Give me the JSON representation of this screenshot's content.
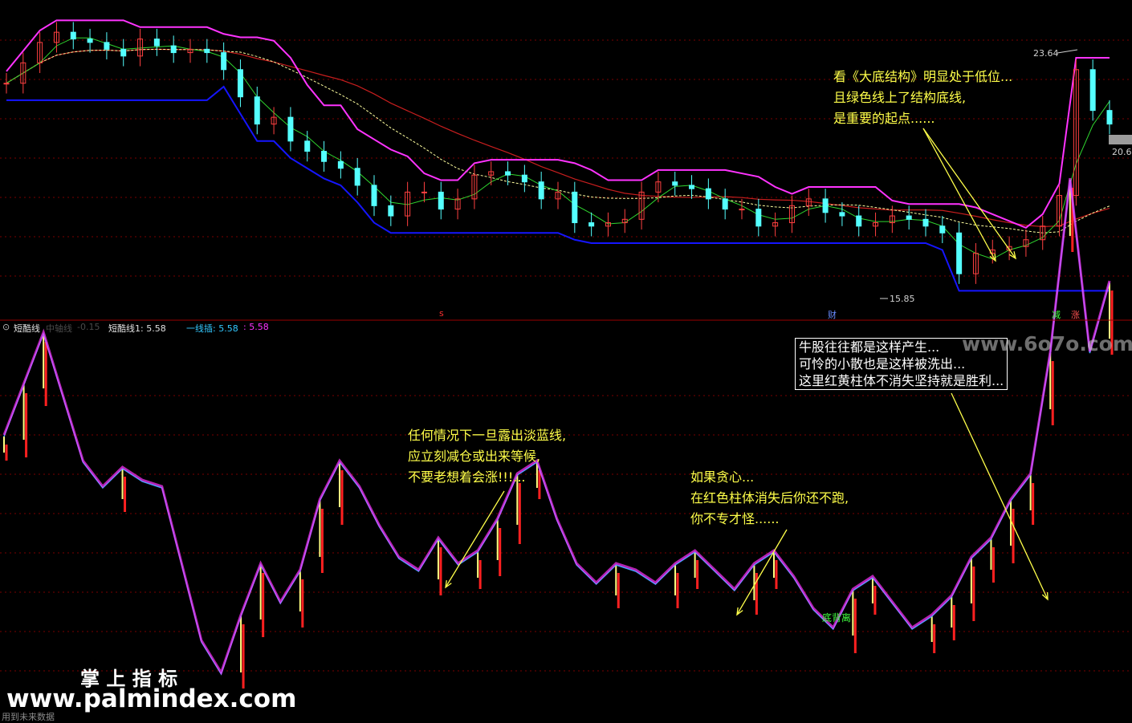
{
  "colors": {
    "background": "#000000",
    "grid": "#7a0000",
    "candle_up": "#ff4040",
    "candle_down": "#54ffff",
    "upper_band": "#ff33ff",
    "lower_band": "#1515ff",
    "green_line": "#2fd52f",
    "ma_red": "#c81e1e",
    "ma_dashed": "#ffffa0",
    "osc_line": "#3aa8ff",
    "osc_fill": "#ff33ff",
    "bar_red": "#ff2020",
    "bar_yellow": "#ffff80",
    "annotation": "#ffff4a"
  },
  "upper_panel": {
    "labels": {
      "high": "23.64",
      "low": "15.85",
      "last": "20.6",
      "mark_s": "s",
      "mark_cai": "财",
      "mark_jian": "减",
      "mark_zhang": "涨"
    },
    "annotation": "看《大底结构》明显处于低位...\n且绿色线上了结构底线,\n是重要的起点......"
  },
  "indicator_bar": {
    "name": "短酷线",
    "dim_label": "中轴线",
    "dim_value": "-0.15",
    "line1_label": "短酷线1: 5.58",
    "line2_label": "一线插: 5.58",
    "line2_value": ": 5.58"
  },
  "lower_panel": {
    "annotation_1": "任何情况下一旦露出淡蓝线,\n应立刻减仓或出来等候,\n不要老想着会涨!!!...",
    "annotation_2": "如果贪心...\n在红色柱体消失后你还不跑,\n你不专才怪......",
    "annotation_3": "牛股往往都是这样产生...\n可怜的小散也是这样被洗出...\n这里红黄柱体不消失坚持就是胜利...",
    "divergence_label": "底背离"
  },
  "watermarks": {
    "site_top": "www.6o7o.com",
    "brand": "掌 上 指 标",
    "site_bottom": "www.palmindex.com",
    "footer": "用到未来数据"
  },
  "chart_data": [
    {
      "type": "candlestick",
      "panel": "price",
      "x": [
        "1",
        "4",
        "7",
        "10",
        "13",
        "16",
        "19",
        "22",
        "25",
        "28",
        "31",
        "34",
        "37",
        "40",
        "43",
        "46",
        "49",
        "52",
        "55",
        "58",
        "61",
        "64",
        "67",
        "70",
        "73",
        "76",
        "79",
        "82",
        "85",
        "88",
        "91",
        "94",
        "97",
        "100",
        "103",
        "106",
        "109",
        "112",
        "115",
        "118",
        "121",
        "124",
        "127",
        "130",
        "133",
        "136",
        "139",
        "142",
        "145",
        "148",
        "151",
        "154",
        "157",
        "160",
        "163",
        "166",
        "169",
        "172",
        "175",
        "178",
        "181",
        "184",
        "187",
        "190",
        "193",
        "196",
        "199"
      ],
      "close": [
        21.8,
        22.4,
        23.0,
        23.3,
        23.1,
        23.0,
        22.8,
        22.6,
        23.1,
        22.9,
        22.7,
        22.8,
        22.7,
        22.2,
        21.4,
        20.6,
        20.8,
        20.1,
        19.8,
        19.5,
        19.3,
        18.8,
        18.2,
        17.9,
        18.6,
        18.6,
        18.1,
        18.4,
        19.1,
        19.2,
        19.1,
        18.9,
        18.4,
        18.6,
        17.7,
        17.6,
        17.7,
        17.8,
        18.6,
        18.9,
        18.8,
        18.7,
        18.4,
        18.1,
        18.1,
        17.6,
        17.7,
        18.2,
        18.4,
        18.0,
        17.9,
        17.6,
        17.7,
        17.9,
        17.8,
        17.6,
        17.4,
        16.2,
        16.8,
        16.9,
        17.0,
        17.2,
        17.6,
        18.5,
        22.2,
        21.0,
        20.6
      ],
      "ylim": [
        15.0,
        24.2
      ]
    },
    {
      "type": "line",
      "panel": "oscillator",
      "x": [
        "1",
        "4",
        "7",
        "10",
        "13",
        "16",
        "19",
        "22",
        "25",
        "28",
        "31",
        "34",
        "37",
        "40",
        "43",
        "46",
        "49",
        "52",
        "55",
        "58",
        "61",
        "64",
        "67",
        "70",
        "73",
        "76",
        "79",
        "82",
        "85",
        "88",
        "91",
        "94",
        "97",
        "100",
        "103",
        "106",
        "109",
        "112",
        "115",
        "118",
        "121",
        "124",
        "127",
        "130",
        "133",
        "136",
        "139",
        "142",
        "145",
        "148",
        "151",
        "154",
        "157",
        "160",
        "163",
        "166",
        "169",
        "172",
        "175",
        "178",
        "181",
        "184",
        "187",
        "190",
        "193",
        "196",
        "199"
      ],
      "series": [
        {
          "values": [
            4.2,
            5.0,
            5.8,
            4.8,
            3.8,
            3.4,
            3.7,
            3.5,
            3.4,
            2.2,
            1.0,
            0.5,
            1.4,
            2.2,
            1.6,
            2.1,
            3.2,
            3.8,
            3.4,
            2.8,
            2.3,
            2.1,
            2.6,
            2.2,
            2.4,
            2.9,
            3.6,
            3.8,
            2.9,
            2.2,
            1.9,
            2.2,
            2.1,
            1.9,
            2.2,
            2.4,
            2.1,
            1.8,
            2.2,
            2.4,
            2.0,
            1.5,
            1.2,
            1.8,
            2.0,
            1.6,
            1.2,
            1.4,
            1.7,
            2.3,
            2.6,
            3.2,
            3.6,
            5.5,
            8.2,
            5.5,
            6.6
          ]
        }
      ]
    }
  ]
}
